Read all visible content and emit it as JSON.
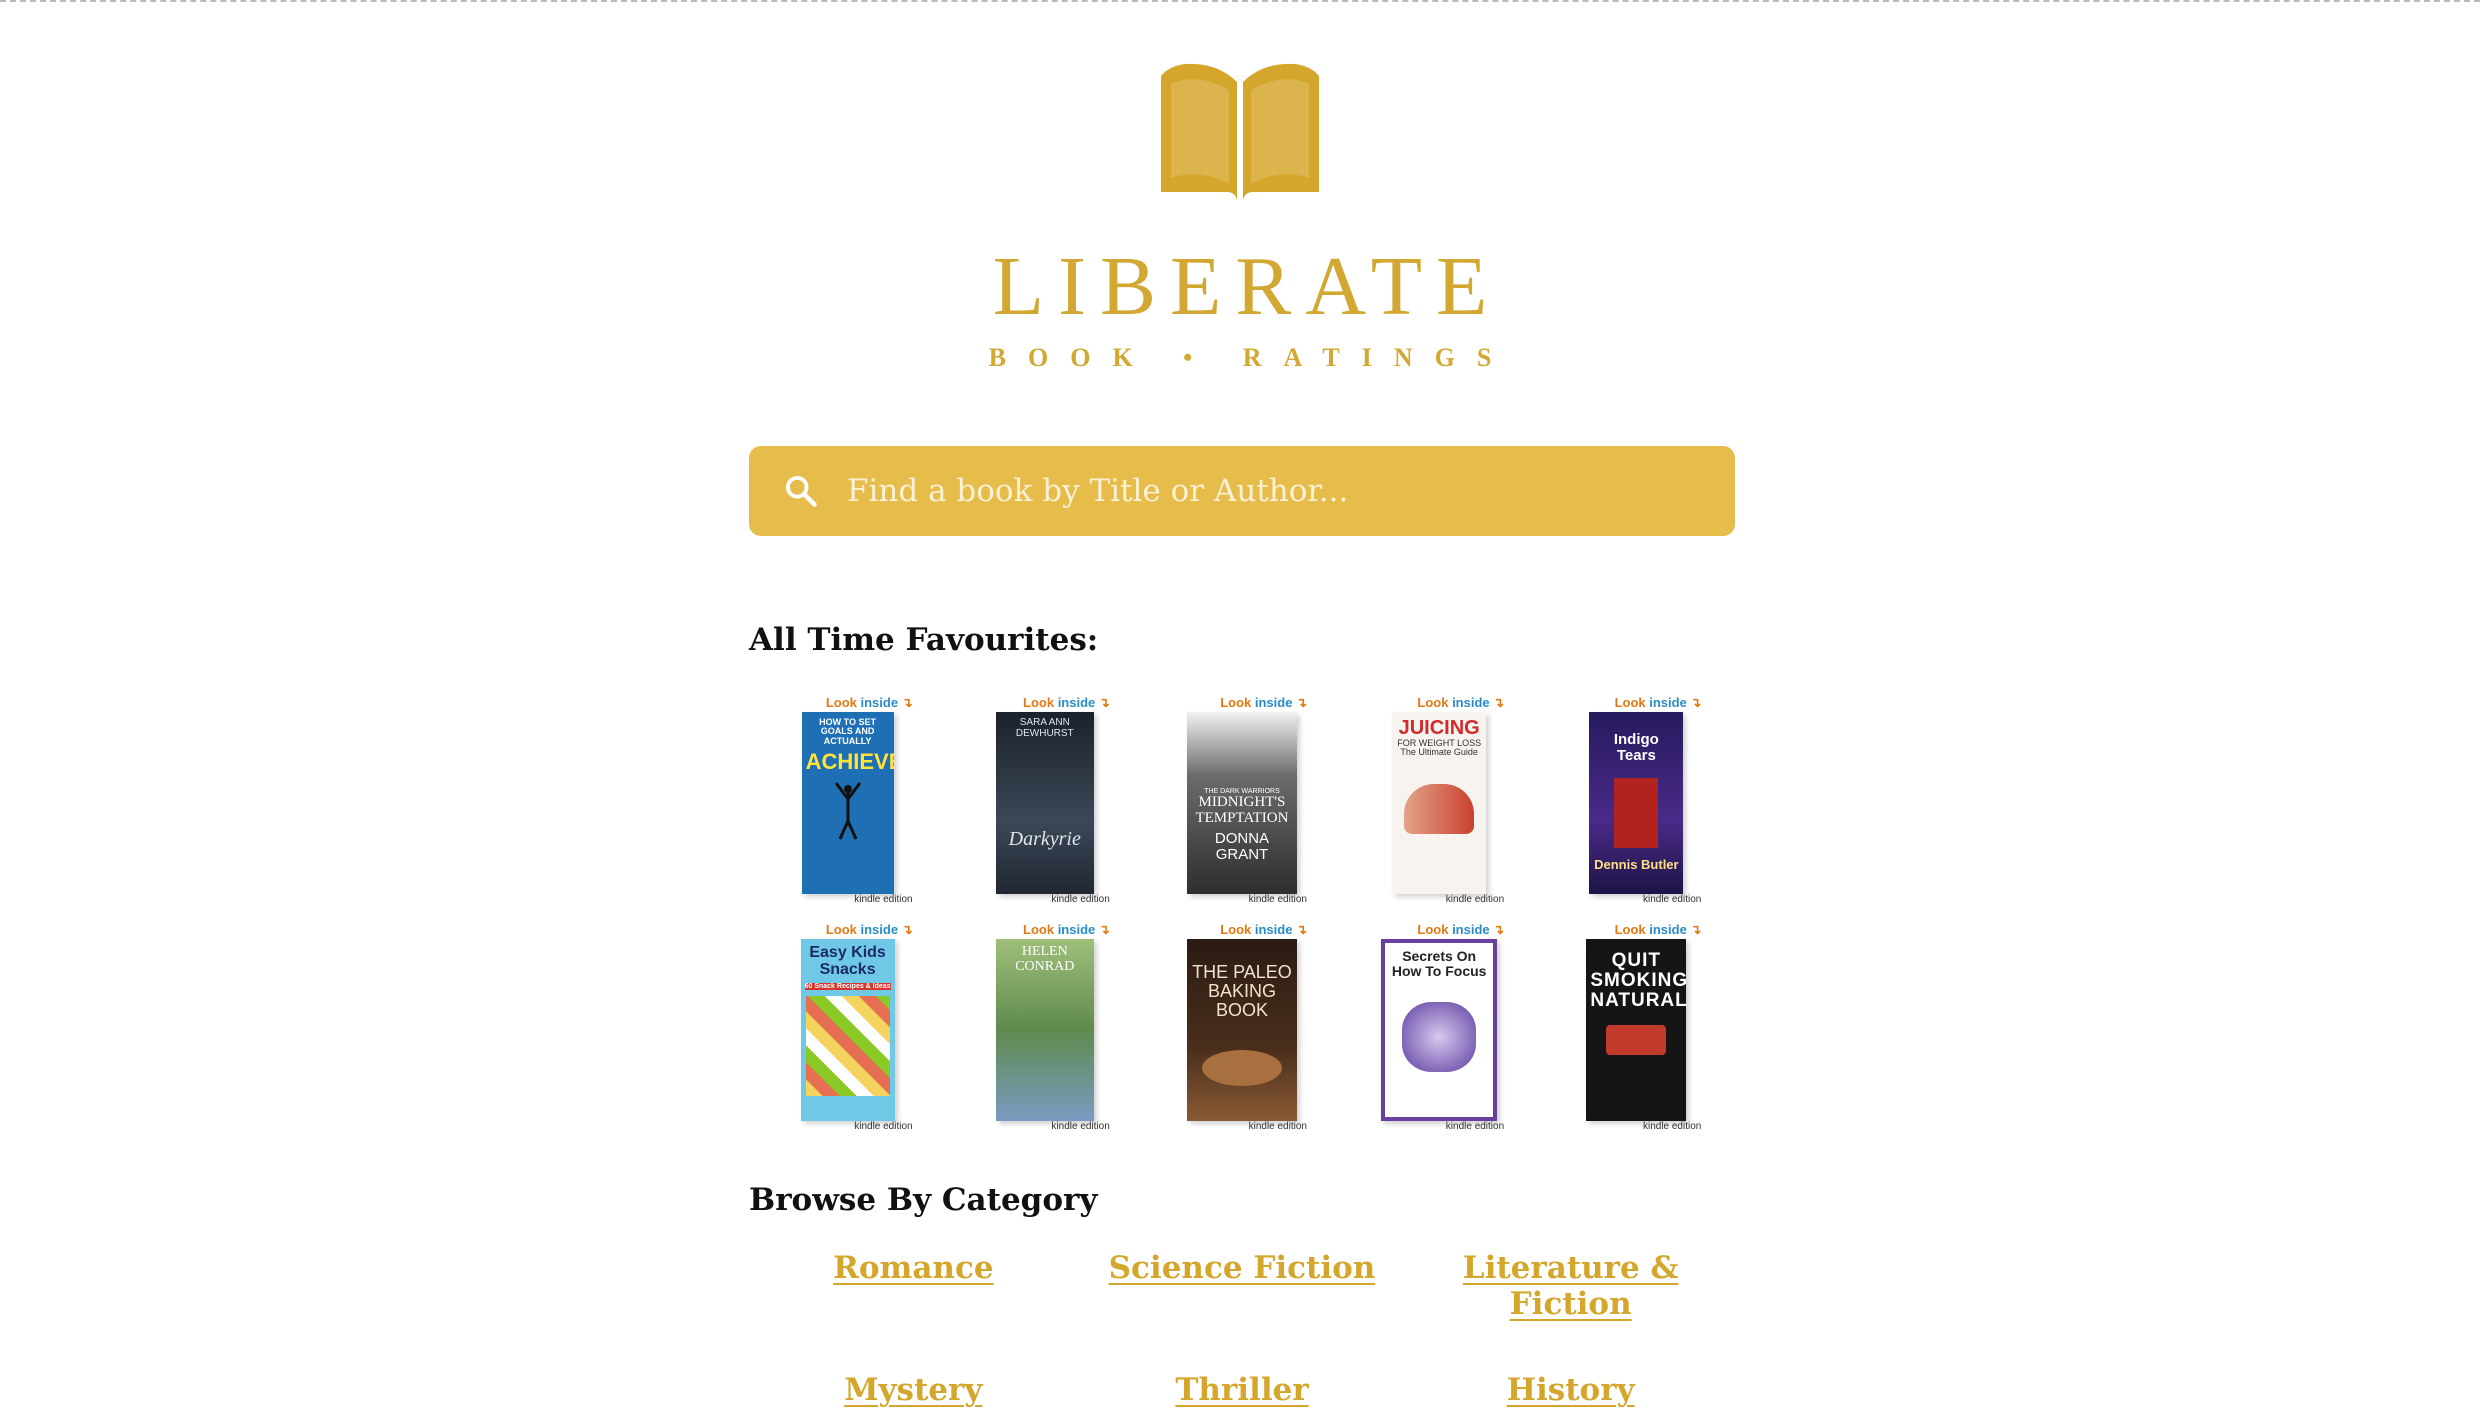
{
  "brand": {
    "name": "LIBERATE",
    "tagline": "BOOK • RATINGS"
  },
  "search": {
    "placeholder": "Find a book by Title or Author..."
  },
  "sections": {
    "favourites_heading": "All Time Favourites:",
    "browse_heading": "Browse By Category"
  },
  "book_badges": {
    "look_inside_1": "Look",
    "look_inside_2": "inside",
    "kindle": "kindle edition"
  },
  "books": [
    {
      "title": "ACHIEVE",
      "subtitle": "HOW TO SET GOALS AND ACTUALLY",
      "author": "",
      "bg": "#1f6fb5",
      "fg": "#ffe23a"
    },
    {
      "title": "Darkyrie",
      "subtitle": "SARA ANN DEWHURST",
      "author": "",
      "bg": "#2c3440",
      "fg": "#dfe6ee"
    },
    {
      "title": "MIDNIGHT'S TEMPTATION",
      "subtitle": "THE DARK WARRIORS",
      "author": "DONNA GRANT",
      "bg": "#3c3d3a",
      "fg": "#ffffff"
    },
    {
      "title": "JUICING",
      "subtitle": "FOR WEIGHT LOSS The Ultimate Guide",
      "author": "",
      "bg": "#f7f3ee",
      "fg": "#d22b2b"
    },
    {
      "title": "Indigo Tears",
      "subtitle": "",
      "author": "Dennis Butler",
      "bg": "#2c1f6b",
      "fg": "#ffe080"
    },
    {
      "title": "Easy Kids Snacks",
      "subtitle": "60 Snack Recipes & Ideas",
      "author": "",
      "bg": "#6ec8e6",
      "fg": "#1c2a6b"
    },
    {
      "title": "HELEN CONRAD",
      "subtitle": "",
      "author": "",
      "bg": "#6a8d5a",
      "fg": "#ffffff"
    },
    {
      "title": "THE PALEO BAKING BOOK",
      "subtitle": "",
      "author": "",
      "bg": "#2b1b13",
      "fg": "#f0e3cc"
    },
    {
      "title": "Secrets On How To Focus",
      "subtitle": "",
      "author": "",
      "bg": "#ffffff",
      "fg": "#222222"
    },
    {
      "title": "QUIT SMOKING NATURALLY",
      "subtitle": "",
      "author": "",
      "bg": "#151515",
      "fg": "#ffffff"
    }
  ],
  "categories": [
    "Romance",
    "Science Fiction",
    "Literature & Fiction",
    "Mystery",
    "Thriller",
    "History"
  ],
  "colors": {
    "accent": "#d2a832",
    "search_bg": "#e6bc4a",
    "link": "#d4a72c"
  }
}
